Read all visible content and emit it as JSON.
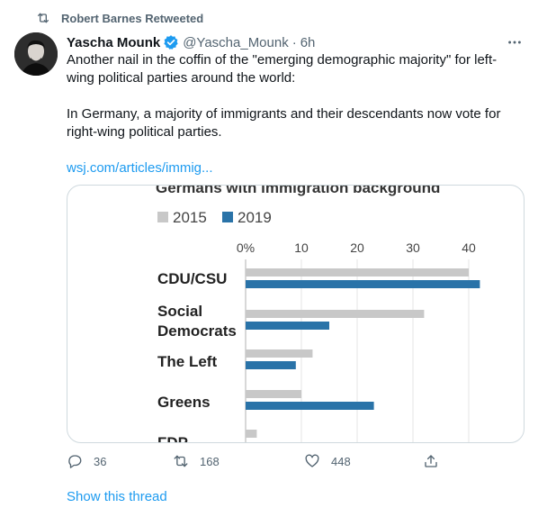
{
  "retweet": {
    "text": "Robert Barnes Retweeted"
  },
  "tweet": {
    "author_name": "Yascha Mounk",
    "handle": "@Yascha_Mounk",
    "separator": "·",
    "time": "6h",
    "text_p1": "Another nail in the coffin of the \"emerging demographic majority\" for left-wing political parties around the world:",
    "text_p2": "In Germany, a majority of immigrants and their descendants now vote for right-wing political parties.",
    "link_text": "wsj.com/articles/immig...",
    "stats": {
      "replies": "36",
      "retweets": "168",
      "likes": "448"
    },
    "show_thread": "Show this thread"
  },
  "chart_data": {
    "type": "bar",
    "title": "Germans with immigration background",
    "categories": [
      "CDU/CSU",
      "Social Democrats",
      "The Left",
      "Greens",
      "FDP"
    ],
    "category_lines": [
      [
        "CDU/CSU"
      ],
      [
        "Social",
        "Democrats"
      ],
      [
        "The Left"
      ],
      [
        "Greens"
      ],
      [
        "FDP"
      ]
    ],
    "series": [
      {
        "name": "2015",
        "color": "#c8c8c8",
        "values": [
          40,
          32,
          12,
          10,
          2
        ]
      },
      {
        "name": "2019",
        "color": "#2a73a8",
        "values": [
          42,
          15,
          9,
          23,
          null
        ]
      }
    ],
    "x_ticks": [
      "0%",
      "10",
      "20",
      "30",
      "40"
    ],
    "xlim": [
      0,
      45
    ]
  },
  "colors": {
    "accent": "#1d9bf0",
    "muted": "#536471"
  }
}
